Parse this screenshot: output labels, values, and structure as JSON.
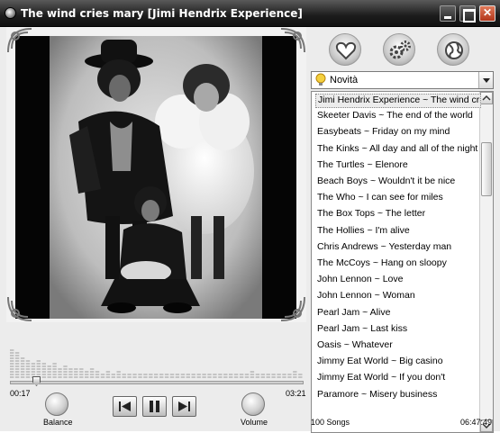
{
  "window": {
    "title": "The wind cries mary [Jimi Hendrix Experience]"
  },
  "player": {
    "elapsed": "00:17",
    "total": "03:21",
    "progress_fraction": 0.085,
    "balance_label": "Balance",
    "volume_label": "Volume"
  },
  "toolbar_icons": [
    "heart-icon",
    "gears-icon",
    "globe-icon"
  ],
  "filter": {
    "selected": "Novità",
    "icon": "bulb-icon"
  },
  "playlist": {
    "selected_index": 0,
    "items": [
      "Jimi Hendrix Experience ~ The wind cries mary",
      "Skeeter Davis ~ The end of the world",
      "Easybeats ~ Friday on my mind",
      "The Kinks ~ All day and all of the night",
      "The Turtles ~ Elenore",
      "Beach Boys ~ Wouldn't it be nice",
      "The Who ~ I can see for miles",
      "The Box Tops ~ The letter",
      "The Hollies ~ I'm alive",
      "Chris Andrews ~ Yesterday man",
      "The McCoys ~ Hang on sloopy",
      "John Lennon ~ Love",
      "John Lennon ~ Woman",
      "Pearl Jam ~ Alive",
      "Pearl Jam ~ Last kiss",
      "Oasis ~ Whatever",
      "Jimmy Eat World ~ Big casino",
      "Jimmy Eat World ~ If you don't",
      "Paramore ~ Misery business"
    ]
  },
  "status": {
    "song_count": "100 Songs",
    "total_time": "06:47:49"
  },
  "colors": {
    "titlebar": "#1c1c1c",
    "panel": "#ececec",
    "spectrum_bar": "#c4c4c4"
  }
}
